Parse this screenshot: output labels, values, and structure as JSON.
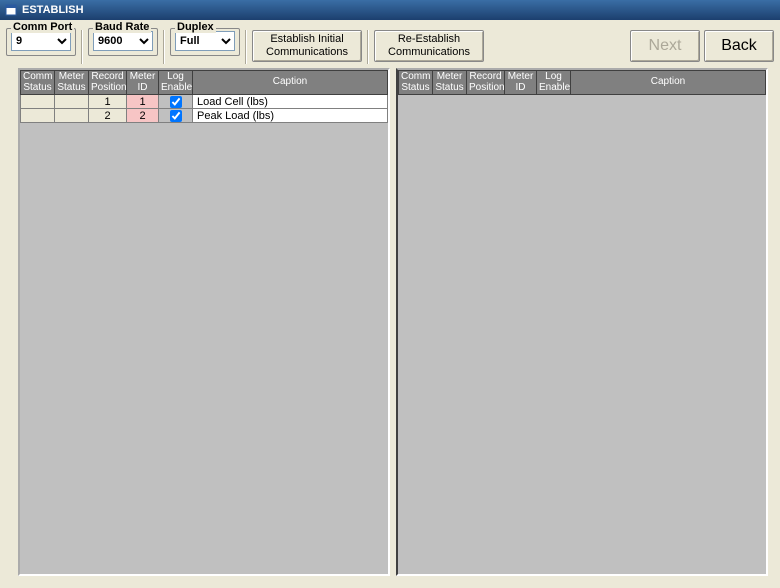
{
  "window": {
    "title": "ESTABLISH"
  },
  "toolbar": {
    "comm_port": {
      "label": "Comm Port",
      "value": "9",
      "options": [
        "9"
      ]
    },
    "baud_rate": {
      "label": "Baud Rate",
      "value": "9600",
      "options": [
        "9600"
      ]
    },
    "duplex": {
      "label": "Duplex",
      "value": "Full",
      "options": [
        "Full"
      ]
    },
    "establish_btn": "Establish Initial Communications",
    "reestablish_btn": "Re-Establish Communications",
    "next_btn": "Next",
    "back_btn": "Back"
  },
  "columns": {
    "comm_status": "Comm Status",
    "meter_status": "Meter Status",
    "record_pos": "Record Position",
    "meter_id": "Meter ID",
    "log_enable": "Log Enable",
    "caption": "Caption"
  },
  "left_rows": [
    {
      "comm": "",
      "meter": "",
      "record": "1",
      "id": "1",
      "log": true,
      "caption": "Load Cell (lbs)"
    },
    {
      "comm": "",
      "meter": "",
      "record": "2",
      "id": "2",
      "log": true,
      "caption": "Peak Load (lbs)"
    }
  ],
  "right_rows": []
}
